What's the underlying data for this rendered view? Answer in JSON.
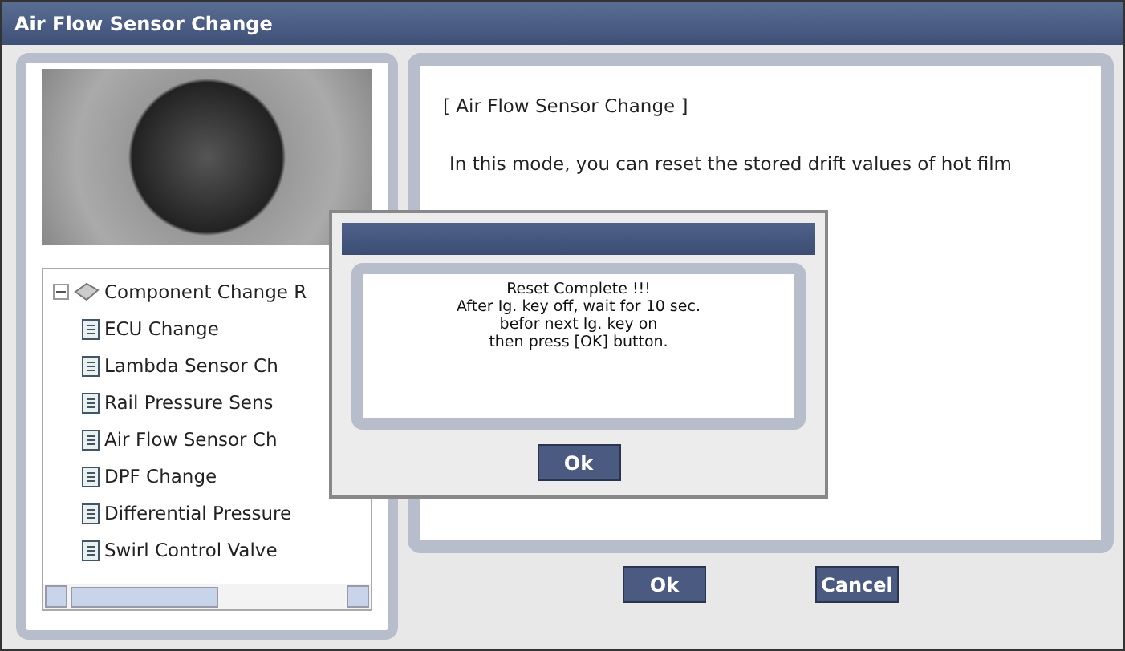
{
  "window": {
    "title": "Air Flow Sensor Change"
  },
  "tree": {
    "label": "Component Change R",
    "expanded": true,
    "children": [
      {
        "label": "ECU Change"
      },
      {
        "label": "Lambda Sensor Ch"
      },
      {
        "label": "Rail Pressure Sens"
      },
      {
        "label": "Air Flow Sensor Ch"
      },
      {
        "label": "DPF Change"
      },
      {
        "label": "Differential Pressure"
      },
      {
        "label": "Swirl Control Valve"
      }
    ]
  },
  "description": {
    "heading": "[ Air Flow Sensor Change ]",
    "text": "In this mode, you can reset the stored drift values of hot film"
  },
  "buttons": [
    "Ok",
    "Cancel"
  ],
  "dialog": {
    "lines": [
      "Reset Complete !!!",
      "After Ig. key off, wait for 10 sec.",
      "befor next Ig. key on",
      "then press [OK] button."
    ],
    "button": "Ok"
  }
}
